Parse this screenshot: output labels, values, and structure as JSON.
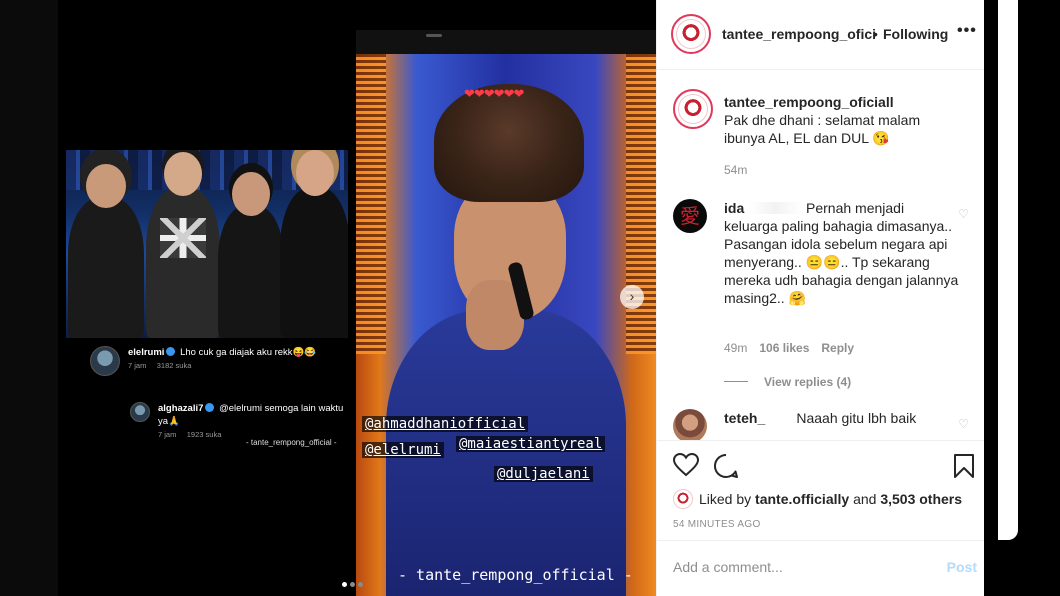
{
  "post_media": {
    "left_panel": {
      "comment1": {
        "user": "elelrumi",
        "text": "Lho cuk ga diajak aku rekk😝😂",
        "time": "7 jam",
        "likes": "3182 suka"
      },
      "comment2": {
        "user": "alghazali7",
        "text": "@elelrumi semoga lain waktu ya🙏",
        "time": "7 jam",
        "likes": "1923 suka"
      },
      "watermark": "- tante_rempong_official -"
    },
    "video": {
      "hearts": "❤❤❤❤❤❤",
      "tags": [
        "@ahmaddhaniofficial",
        "@elelrumi",
        "@maiaestiantyreal",
        "@duljaelani"
      ],
      "watermark": "- tante_rempong_official -"
    },
    "next_icon": "chevron-right-icon",
    "carousel": {
      "count": 3,
      "active": 0
    }
  },
  "header": {
    "username": "tantee_rempoong_ofici",
    "separator": "•",
    "follow_state": "Following",
    "more_icon": "•••"
  },
  "comments": {
    "caption": {
      "user": "tantee_rempoong_oficiall",
      "text": "Pak dhe dhani : selamat malam ibunya AL, EL dan DUL 😘",
      "time": "54m"
    },
    "ida": {
      "user": "ida",
      "avatar_glyph": "愛",
      "text": "Pernah menjadi keluarga paling bahagia dimasanya.. Pasangan idola sebelum negara api menyerang.. 😑😑.. Tp sekarang mereka udh bahagia dengan jalannya masing2.. 🤗",
      "time": "49m",
      "likes": "106 likes",
      "reply": "Reply",
      "view_replies": "View replies (4)"
    },
    "teteh": {
      "user": "teteh_",
      "text": "Naaah gitu lbh baik"
    }
  },
  "actions": {
    "liked_by_prefix": "Liked by",
    "liked_by_user": "tante.officially",
    "liked_by_and": "and",
    "liked_by_count": "3,503 others",
    "timestamp": "54 MINUTES AGO"
  },
  "add_comment": {
    "placeholder": "Add a comment...",
    "post_label": "Post"
  },
  "colors": {
    "accent_blue": "#3897f0",
    "post_disabled": "#b3dbff",
    "ring": "#e0385a"
  }
}
